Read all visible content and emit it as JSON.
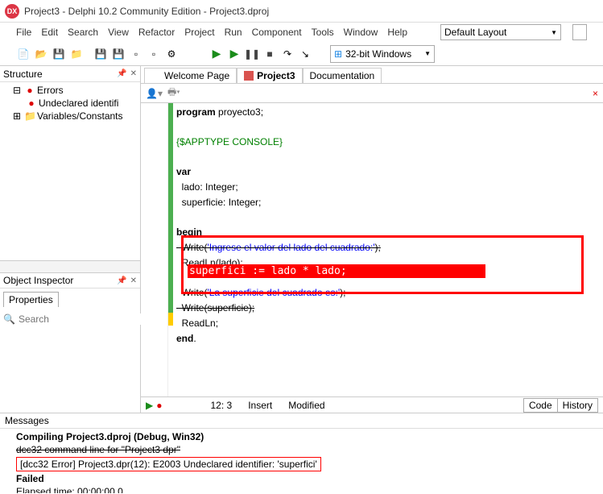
{
  "title": "Project3 - Delphi 10.2 Community Edition - Project3.dproj",
  "menu": [
    "File",
    "Edit",
    "Search",
    "View",
    "Refactor",
    "Project",
    "Run",
    "Component",
    "Tools",
    "Window",
    "Help"
  ],
  "layout_select": "Default Layout",
  "platform_select": "32-bit Windows",
  "structure": {
    "header": "Structure",
    "nodes": {
      "errors": "Errors",
      "undeclared": "Undeclared identifi",
      "varsconsts": "Variables/Constants"
    }
  },
  "object_inspector": {
    "header": "Object Inspector",
    "tab": "Properties",
    "search_placeholder": "Search"
  },
  "tabs": {
    "welcome": "Welcome Page",
    "project": "Project3",
    "docs": "Documentation"
  },
  "code": {
    "l1a": "program",
    "l1b": " proyecto3;",
    "l2": "{$APPTYPE CONSOLE}",
    "l3a": "var",
    "l4": "  lado: Integer;",
    "l5": "  superficie: Integer;",
    "l6a": "begin",
    "l7a": "  Write(",
    "l7b": "'Ingrese el valor del lado del cuadrado:'",
    "l7c": ");",
    "l8": "  ReadLn(lado);",
    "l9": "  superfici := lado * lado;",
    "l10a": "  Write(",
    "l10b": "'La superficie del cuadrado es:'",
    "l10c": ");",
    "l11": "  Write(superficie);",
    "l12": "  ReadLn;",
    "l13a": "end",
    "l13b": "."
  },
  "status": {
    "pos": "12:  3",
    "mode": "Insert",
    "modified": "Modified",
    "tab_code": "Code",
    "tab_history": "History"
  },
  "messages": {
    "header": "Messages",
    "compiling": "Compiling Project3.dproj (Debug, Win32)",
    "cmdline": "dcc32 command line for \"Project3 dpr\"",
    "error": "[dcc32 Error] Project3.dpr(12): E2003 Undeclared identifier: 'superfici'",
    "failed": "Failed",
    "elapsed": "Elapsed time: 00:00:00.0"
  }
}
